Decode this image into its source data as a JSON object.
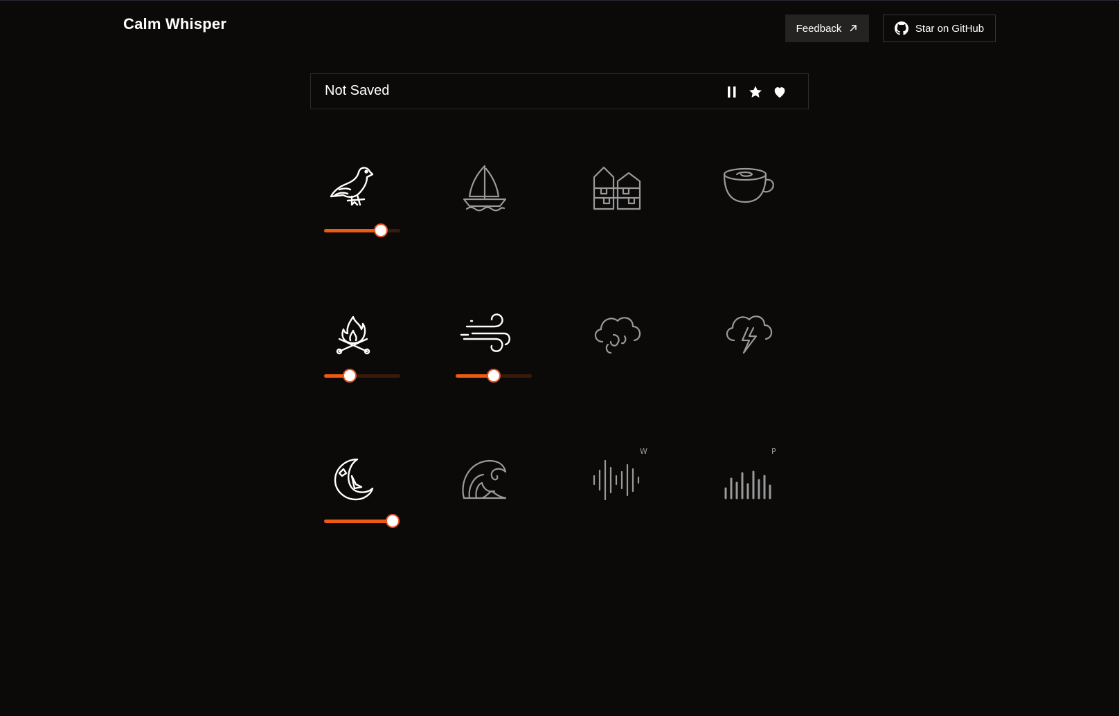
{
  "header": {
    "brand": "Calm Whisper",
    "feedback_label": "Feedback",
    "github_label": "Star on GitHub",
    "feedback_icon": "arrow-up-right-icon",
    "github_icon": "github-icon"
  },
  "preset": {
    "title": "Not Saved",
    "controls": [
      "pause-icon",
      "star-icon",
      "heart-icon"
    ]
  },
  "colors": {
    "background": "#0b0a09",
    "accent": "#ee5a12",
    "track": "#3a1a0a",
    "active_icon": "#ffffff",
    "inactive_icon": "#9a9a9a"
  },
  "sounds": [
    {
      "name": "bird",
      "icon": "bird-icon",
      "active": true,
      "volume": 0.75
    },
    {
      "name": "boat",
      "icon": "sailboat-icon",
      "active": false
    },
    {
      "name": "city",
      "icon": "city-icon",
      "active": false
    },
    {
      "name": "coffee",
      "icon": "coffee-cup-icon",
      "active": false
    },
    {
      "name": "campfire",
      "icon": "campfire-icon",
      "active": true,
      "volume": 0.33
    },
    {
      "name": "wind",
      "icon": "wind-icon",
      "active": true,
      "volume": 0.5
    },
    {
      "name": "rain",
      "icon": "rain-cloud-icon",
      "active": false
    },
    {
      "name": "thunder",
      "icon": "thunder-cloud-icon",
      "active": false
    },
    {
      "name": "night",
      "icon": "moon-stars-icon",
      "active": true,
      "volume": 0.9
    },
    {
      "name": "waves",
      "icon": "wave-icon",
      "active": false
    },
    {
      "name": "white-noise",
      "icon": "sound-wave-icon",
      "badge": "W",
      "active": false
    },
    {
      "name": "pink-noise",
      "icon": "sound-bars-icon",
      "badge": "P",
      "active": false
    }
  ]
}
